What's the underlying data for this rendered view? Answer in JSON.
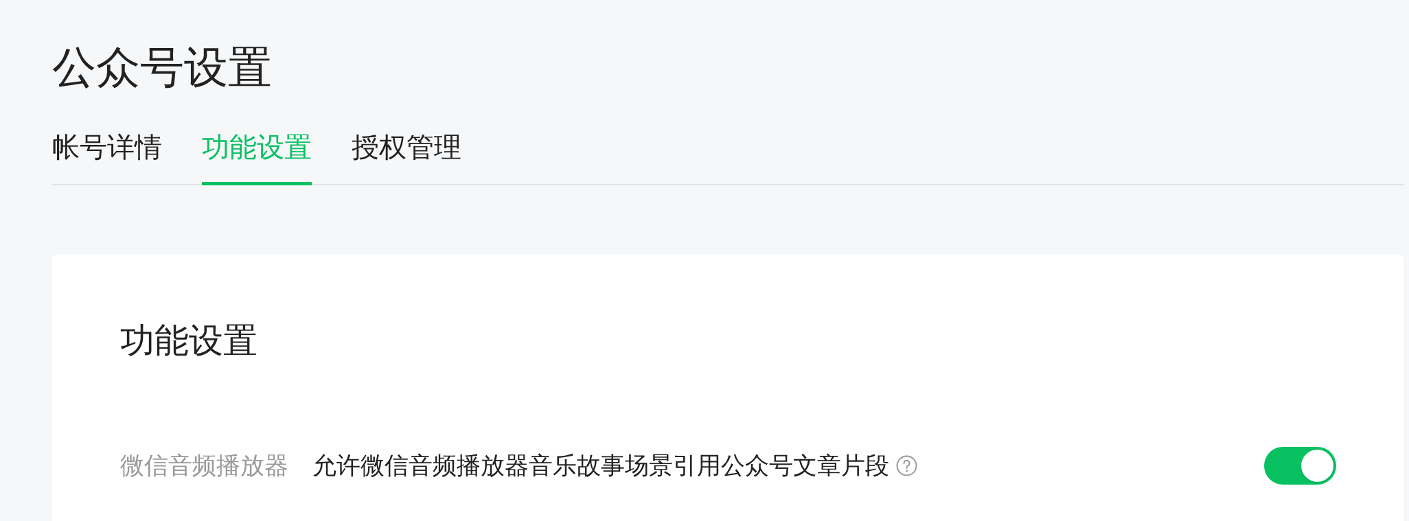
{
  "page_title": "公众号设置",
  "tabs": [
    {
      "label": "帐号详情",
      "selected": false
    },
    {
      "label": "功能设置",
      "selected": true
    },
    {
      "label": "授权管理",
      "selected": false
    }
  ],
  "card": {
    "title": "功能设置",
    "settings": [
      {
        "label": "微信音频播放器",
        "description": "允许微信音频播放器音乐故事场景引用公众号文章片段",
        "on": true
      }
    ]
  }
}
